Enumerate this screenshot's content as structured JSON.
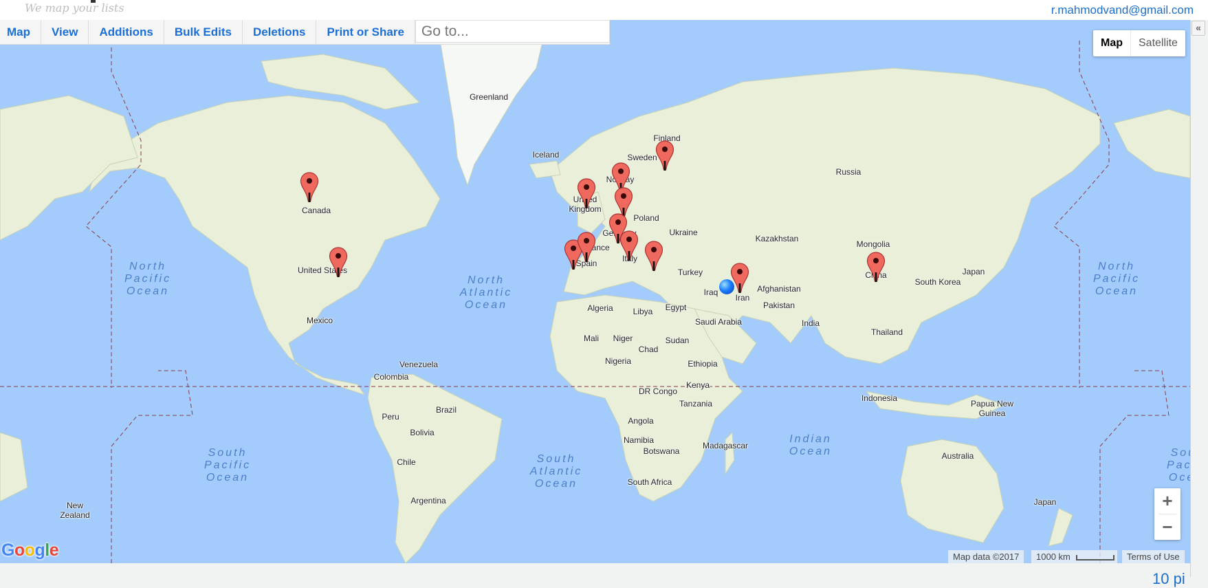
{
  "header": {
    "tagline": "We map your lists",
    "account_email": "r.mahmodvand@gmail.com"
  },
  "toolbar": {
    "tabs": [
      "Map",
      "View",
      "Additions",
      "Bulk Edits",
      "Deletions",
      "Print or Share"
    ],
    "goto_placeholder": "Go to..."
  },
  "map_type": {
    "options": [
      "Map",
      "Satellite"
    ],
    "selected": "Map"
  },
  "zoom_controls": {
    "zoom_in": "+",
    "zoom_out": "−"
  },
  "attribution": {
    "map_data": "Map data ©2017",
    "scale_label": "1000 km",
    "terms": "Terms of Use",
    "logo": [
      "G",
      "o",
      "o",
      "g",
      "l",
      "e"
    ]
  },
  "sidebar": {
    "collapse_label": "«"
  },
  "footer": {
    "partial_text": "10 pi"
  },
  "colors": {
    "ocean": "#a3cbfc",
    "land": "#e9efd9",
    "pin": "#f0695f",
    "link": "#1a6fd6",
    "blue_marker": "#1a7cff"
  },
  "markers": [
    {
      "country": "Canada",
      "type": "pin"
    },
    {
      "country": "United States",
      "type": "pin"
    },
    {
      "country": "United Kingdom",
      "type": "pin"
    },
    {
      "country": "Norway",
      "type": "pin"
    },
    {
      "country": "Denmark",
      "type": "pin"
    },
    {
      "country": "Germany",
      "type": "pin"
    },
    {
      "country": "Portugal",
      "type": "pin"
    },
    {
      "country": "Spain",
      "type": "pin"
    },
    {
      "country": "Italy",
      "type": "pin"
    },
    {
      "country": "Greece",
      "type": "pin"
    },
    {
      "country": "Finland",
      "type": "pin"
    },
    {
      "country": "Iran",
      "type": "pin"
    },
    {
      "country": "China",
      "type": "pin"
    },
    {
      "country": "Iraq",
      "type": "current-location"
    }
  ],
  "country_labels": [
    "Greenland",
    "Iceland",
    "Finland",
    "Sweden",
    "Norway",
    "Russia",
    "United Kingdom",
    "Poland",
    "Germany",
    "Ukraine",
    "Kazakhstan",
    "Mongolia",
    "Canada",
    "United States",
    "France",
    "Spain",
    "Italy",
    "Turkey",
    "Japan",
    "South Korea",
    "China",
    "Iraq",
    "Iran",
    "Afghanistan",
    "Pakistan",
    "Algeria",
    "Libya",
    "Egypt",
    "Saudi Arabia",
    "India",
    "Mexico",
    "Mali",
    "Niger",
    "Sudan",
    "Chad",
    "Thailand",
    "Nigeria",
    "Ethiopia",
    "Venezuela",
    "Colombia",
    "Kenya",
    "Indonesia",
    "Papua New Guinea",
    "DR Congo",
    "Tanzania",
    "Brazil",
    "Peru",
    "Bolivia",
    "Angola",
    "Namibia",
    "Botswana",
    "Madagascar",
    "Australia",
    "Chile",
    "South Africa",
    "Argentina",
    "New Zealand",
    "Japan"
  ],
  "ocean_labels": [
    "North Pacific Ocean",
    "North Atlantic Ocean",
    "South Pacific Ocean",
    "South Atlantic Ocean",
    "Indian Ocean",
    "North Pacific Ocean",
    "South Pacific Ocean"
  ]
}
